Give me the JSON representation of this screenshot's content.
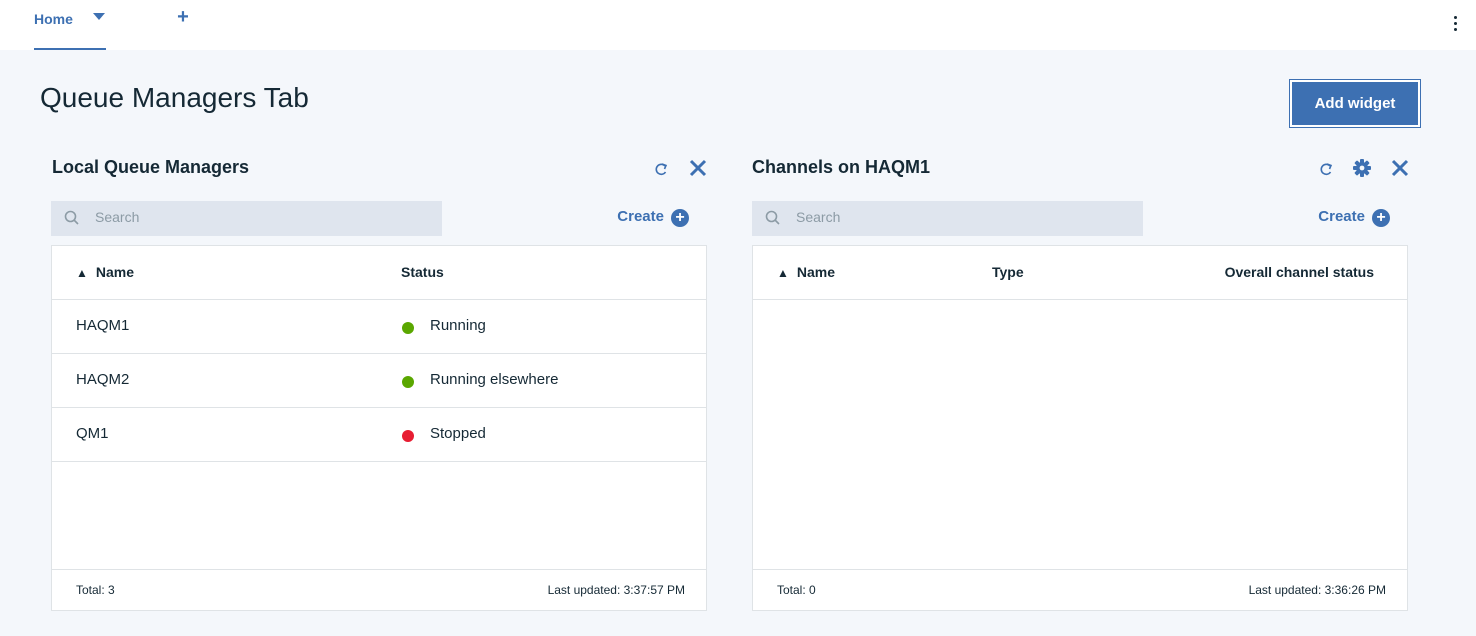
{
  "tabs": {
    "active_label": "Home"
  },
  "page": {
    "title": "Queue Managers Tab",
    "add_widget_label": "Add widget"
  },
  "colors": {
    "accent": "#3d70b2",
    "running": "#5aa700",
    "stopped": "#e71d32",
    "background": "#f4f7fb"
  },
  "widgets": {
    "local_qm": {
      "title": "Local Queue Managers",
      "search_placeholder": "Search",
      "create_label": "Create",
      "columns": [
        "Name",
        "Status"
      ],
      "rows": [
        {
          "name": "HAQM1",
          "status": "Running",
          "status_color": "#5aa700"
        },
        {
          "name": "HAQM2",
          "status": "Running elsewhere",
          "status_color": "#5aa700"
        },
        {
          "name": "QM1",
          "status": "Stopped",
          "status_color": "#e71d32"
        }
      ],
      "total": "Total: 3",
      "last_updated": "Last updated: 3:37:57 PM"
    },
    "channels": {
      "title": "Channels on HAQM1",
      "search_placeholder": "Search",
      "create_label": "Create",
      "columns": [
        "Name",
        "Type",
        "Overall channel status"
      ],
      "rows": [],
      "total": "Total: 0",
      "last_updated": "Last updated: 3:36:26 PM"
    }
  },
  "icons": [
    "chevron-down-icon",
    "add-icon",
    "overflow-menu-icon",
    "refresh-icon",
    "close-icon",
    "gear-icon",
    "search-icon",
    "add-circle-icon",
    "sort-ascending-icon",
    "status-dot-icon"
  ]
}
